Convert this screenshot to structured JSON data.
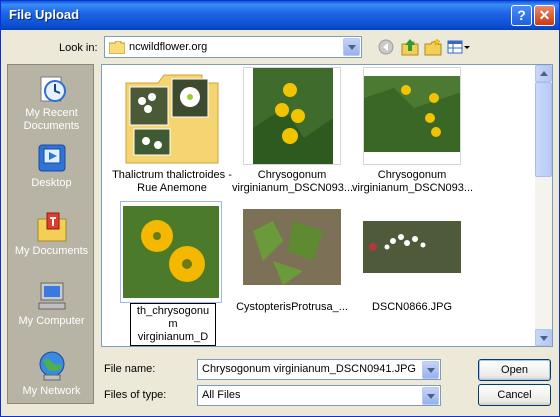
{
  "window": {
    "title": "File Upload",
    "help_icon": "question-mark",
    "close_icon": "x-close"
  },
  "toolbar": {
    "look_in_label": "Look in:",
    "look_in_value": "ncwildflower.org",
    "tools": [
      "back-arrow-icon",
      "up-folder-icon",
      "new-folder-icon",
      "views-menu-icon"
    ]
  },
  "places": [
    {
      "label": "My Recent\nDocuments",
      "icon": "recent-documents-icon"
    },
    {
      "label": "Desktop",
      "icon": "desktop-icon"
    },
    {
      "label": "My Documents",
      "icon": "my-documents-icon"
    },
    {
      "label": "My Computer",
      "icon": "my-computer-icon"
    },
    {
      "label": "My Network",
      "icon": "my-network-icon"
    }
  ],
  "files": [
    {
      "name": "Thalictrum thalictroides -\nRue Anemone",
      "kind": "folder"
    },
    {
      "name": "Chrysogonum\nvirginianum_DSCN093...",
      "kind": "image"
    },
    {
      "name": "Chrysogonum\nvirginianum_DSCN093...",
      "kind": "image"
    },
    {
      "name": "th_chrysogonu\nm\nvirginianum_D",
      "kind": "image",
      "selected": true,
      "renaming": true
    },
    {
      "name": "CystopterisProtrusa_...",
      "kind": "image"
    },
    {
      "name": "DSCN0866.JPG",
      "kind": "image"
    }
  ],
  "form": {
    "file_name_label": "File name:",
    "file_name_value": "Chrysogonum virginianum_DSCN0941.JPG",
    "file_type_label": "Files of type:",
    "file_type_value": "All Files",
    "open_label": "Open",
    "cancel_label": "Cancel"
  },
  "colors": {
    "titlebar": "#0b4fd2",
    "places_bar": "#b8b4a5",
    "dialog": "#ece9d8"
  }
}
